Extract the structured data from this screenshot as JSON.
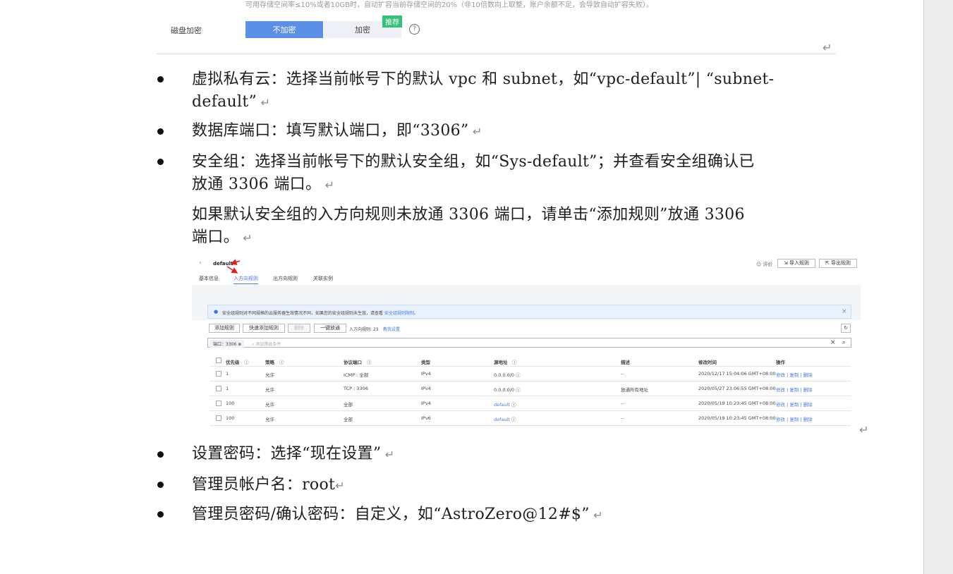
{
  "top_form": {
    "note": "可用存储空间率≤10%或者10GB时，自动扩容当前存储空间的20%（非10倍数向上取整，账户余额不足，会导致自动扩容失败）。",
    "field_label": "磁盘加密",
    "options": [
      "不加密",
      "加密"
    ],
    "selected": "不加密",
    "badge": "推荐",
    "help_icon": "question-circle-icon"
  },
  "bullets": [
    {
      "lines": [
        "虚拟私有云：选择当前帐号下的默认 vpc 和 subnet，如“vpc-default”| “subnet-",
        "default”"
      ]
    },
    {
      "lines": [
        "数据库端口：填写默认端口，即“3306”"
      ]
    },
    {
      "lines": [
        "安全组：选择当前帐号下的默认安全组，如“Sys-default”；并查看安全组确认已",
        "放通 3306 端口。"
      ]
    }
  ],
  "continuation": [
    "如果默认安全组的入方向规则未放通 3306 端口，请单击“添加规则”放通 3306",
    "端口。"
  ],
  "bullets2": [
    {
      "lines": [
        "设置密码：选择“现在设置”"
      ]
    },
    {
      "lines": [
        "管理员帐户名：root"
      ]
    },
    {
      "lines": [
        "管理员密码/确认密码：自定义，如“AstroZero@12#$”"
      ]
    }
  ],
  "security_group": {
    "name": "default",
    "eval": "评价",
    "import_btn": "导入规则",
    "export_btn": "导出规则",
    "tabs": [
      "基本信息",
      "入方向规则",
      "出方向规则",
      "关联实例"
    ],
    "active_tab": "入方向规则",
    "info_text": "安全组规则对不同规格的云服务器生效情况不同，如果您的安全组规则未生效，请查看",
    "info_link": "安全组规则限制。",
    "toolbar": {
      "add": "添加规则",
      "quick_add": "快速添加规则",
      "delete": "删除",
      "one_click": "一键放通",
      "count": "入方向规则: 23",
      "tutorial": "教我设置"
    },
    "filter_tag": "端口：3306",
    "filter_placeholder": "添加筛选条件",
    "columns": [
      "优先级",
      "策略",
      "协议端口",
      "类型",
      "源地址",
      "描述",
      "修改时间",
      "操作"
    ],
    "rows": [
      {
        "priority": "1",
        "policy": "允许",
        "port": "ICMP : 全部",
        "type": "IPv4",
        "source": "0.0.0.0/0",
        "desc": "--",
        "time": "2020/12/17 15:04:06 GMT+08:00"
      },
      {
        "priority": "1",
        "policy": "允许",
        "port": "TCP : 3306",
        "type": "IPv4",
        "source": "0.0.0.0/0",
        "desc": "放通所有地址",
        "time": "2020/05/27 23:06:55 GMT+08:00"
      },
      {
        "priority": "100",
        "policy": "允许",
        "port": "全部",
        "type": "IPv4",
        "source": "default",
        "desc": "--",
        "time": "2020/05/19 10:23:45 GMT+08:00"
      },
      {
        "priority": "100",
        "policy": "允许",
        "port": "全部",
        "type": "IPv6",
        "source": "default",
        "desc": "--",
        "time": "2020/05/19 10:23:45 GMT+08:00"
      }
    ],
    "actions": [
      "修改",
      "复制",
      "删除"
    ]
  }
}
